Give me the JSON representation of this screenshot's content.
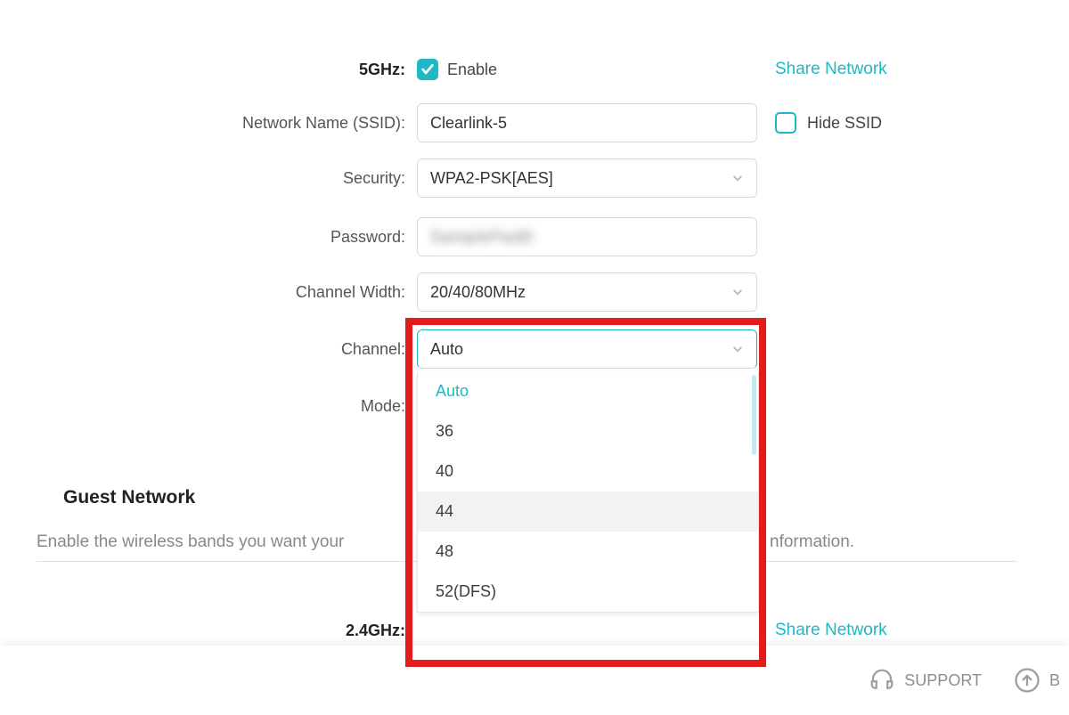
{
  "band5": {
    "label": "5GHz:",
    "enable_label": "Enable",
    "share_link": "Share Network"
  },
  "ssid": {
    "label": "Network Name (SSID):",
    "value": "Clearlink-5",
    "hide_label": "Hide SSID"
  },
  "security": {
    "label": "Security:",
    "value": "WPA2-PSK[AES]"
  },
  "password": {
    "label": "Password:",
    "masked": "SamplePwd0"
  },
  "channel_width": {
    "label": "Channel Width:",
    "value": "20/40/80MHz"
  },
  "channel": {
    "label": "Channel:",
    "value": "Auto",
    "options": [
      "Auto",
      "36",
      "40",
      "44",
      "48",
      "52(DFS)"
    ],
    "hovered_index": 3,
    "active_index": 0
  },
  "mode": {
    "label": "Mode:"
  },
  "guest": {
    "title": "Guest Network",
    "desc_before": "Enable the wireless bands you want your",
    "desc_after": "nformation."
  },
  "band24": {
    "label": "2.4GHz:",
    "share_link": "Share Network"
  },
  "footer": {
    "support": "SUPPORT",
    "back_fragment": "B"
  }
}
